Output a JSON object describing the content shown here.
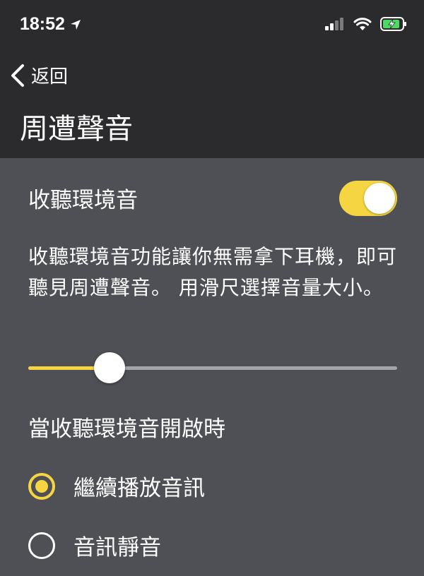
{
  "status_bar": {
    "time": "18:52",
    "icons": [
      "location-arrow-icon",
      "cellular-signal-icon",
      "wifi-icon",
      "battery-charging-icon"
    ]
  },
  "nav": {
    "back_label": "返回",
    "title": "周遭聲音"
  },
  "ambient": {
    "toggle_label": "收聽環境音",
    "toggle_on": true,
    "description": "收聽環境音功能讓你無需拿下耳機，即可聽見周遭聲音。 用滑尺選擇音量大小。",
    "volume_level": 0.22
  },
  "when_on": {
    "heading": "當收聽環境音開啟時",
    "options": [
      {
        "label": "繼續播放音訊",
        "selected": true
      },
      {
        "label": "音訊靜音",
        "selected": false
      }
    ]
  },
  "colors": {
    "accent": "#f5d642",
    "header_bg": "#2b2b2d",
    "content_bg": "#4f5055",
    "track": "#a5a6aa"
  }
}
